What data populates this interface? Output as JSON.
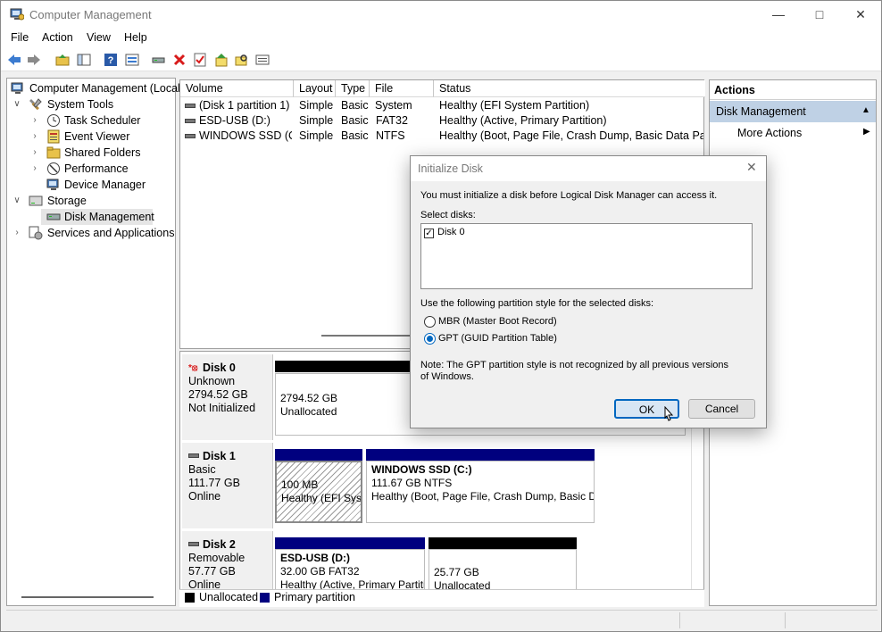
{
  "window": {
    "title": "Computer Management"
  },
  "menu": [
    "File",
    "Action",
    "View",
    "Help"
  ],
  "tree": {
    "root": "Computer Management (Local",
    "system_tools": "System Tools",
    "task_scheduler": "Task Scheduler",
    "event_viewer": "Event Viewer",
    "shared_folders": "Shared Folders",
    "performance": "Performance",
    "device_manager": "Device Manager",
    "storage": "Storage",
    "disk_management": "Disk Management",
    "services": "Services and Applications"
  },
  "volumes": {
    "columns": [
      "Volume",
      "Layout",
      "Type",
      "File System",
      "Status"
    ],
    "rows": [
      [
        "(Disk 1 partition 1)",
        "Simple",
        "Basic",
        "",
        "Healthy (EFI System Partition)"
      ],
      [
        "ESD-USB (D:)",
        "Simple",
        "Basic",
        "FAT32",
        "Healthy (Active, Primary Partition)"
      ],
      [
        "WINDOWS SSD (C:)",
        "Simple",
        "Basic",
        "NTFS",
        "Healthy (Boot, Page File, Crash Dump, Basic Data Partitic"
      ]
    ]
  },
  "disks": {
    "disk0": {
      "name": "Disk 0",
      "type": "Unknown",
      "size": "2794.52 GB",
      "status": "Not Initialized",
      "part_size": "2794.52 GB",
      "part_label": "Unallocated"
    },
    "disk1": {
      "name": "Disk 1",
      "type": "Basic",
      "size": "111.77 GB",
      "status": "Online",
      "p1_size": "100 MB",
      "p1_status": "Healthy (EFI Syst",
      "p2_name": "WINDOWS SSD  (C:)",
      "p2_size": "111.67 GB NTFS",
      "p2_status": "Healthy (Boot, Page File, Crash Dump, Basic Da"
    },
    "disk2": {
      "name": "Disk 2",
      "type": "Removable",
      "size": "57.77 GB",
      "status": "Online",
      "p1_name": "ESD-USB  (D:)",
      "p1_size": "32.00 GB FAT32",
      "p1_status": "Healthy (Active, Primary Partiti",
      "p2_size": "25.77 GB",
      "p2_label": "Unallocated"
    }
  },
  "legend": {
    "unallocated": "Unallocated",
    "primary": "Primary partition",
    "unallocated_color": "#000000",
    "primary_color": "#00007f"
  },
  "actions": {
    "header": "Actions",
    "section": "Disk Management",
    "more": "More Actions"
  },
  "dialog": {
    "title": "Initialize Disk",
    "intro": "You must initialize a disk before Logical Disk Manager can access it.",
    "select_label": "Select disks:",
    "disk_item": "Disk 0",
    "style_label": "Use the following partition style for the selected disks:",
    "mbr": "MBR (Master Boot Record)",
    "gpt": "GPT (GUID Partition Table)",
    "note": "Note: The GPT partition style is not recognized by all previous versions of Windows.",
    "ok": "OK",
    "cancel": "Cancel"
  }
}
